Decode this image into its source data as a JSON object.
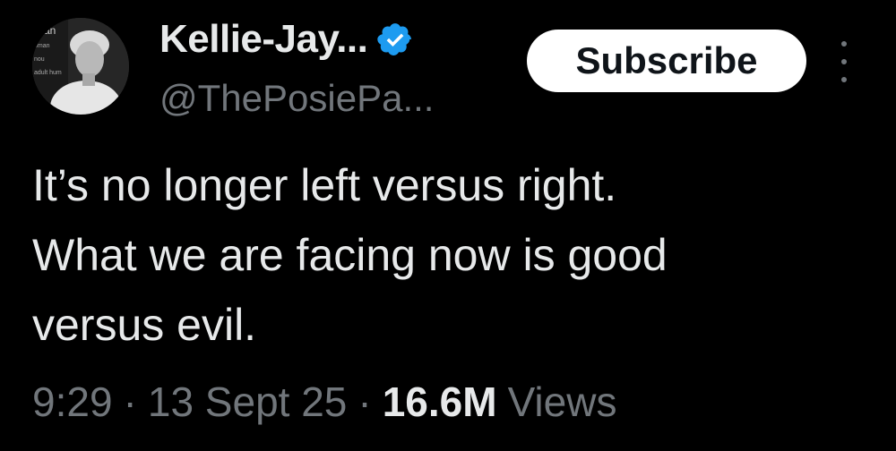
{
  "author": {
    "display_name": "Kellie-Jay...",
    "handle": "@ThePosiePa...",
    "verified_icon": "verified-badge-icon",
    "avatar_text": [
      "man",
      "oman",
      "nou",
      "adult hum"
    ]
  },
  "actions": {
    "subscribe_label": "Subscribe",
    "more_icon": "more-vertical-icon"
  },
  "tweet": {
    "lines": [
      "It’s no longer left versus right.",
      "What we are facing now is good",
      "versus evil."
    ]
  },
  "meta": {
    "time": "9:29",
    "separator": "·",
    "date": "13 Sept 25",
    "views_count": "16.6M",
    "views_label": "Views"
  },
  "colors": {
    "background": "#000000",
    "primary_text": "#e7e9ea",
    "secondary_text": "#71767b",
    "verified_blue": "#1d9bf0",
    "button_bg": "#ffffff"
  }
}
